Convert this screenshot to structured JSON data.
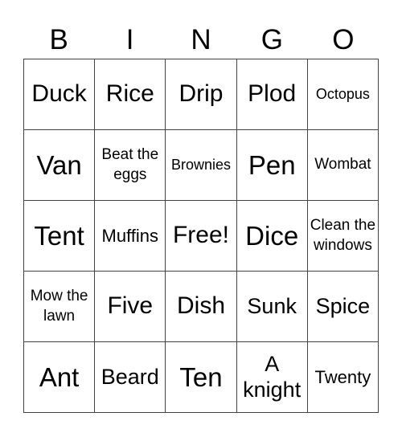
{
  "header": [
    "B",
    "I",
    "N",
    "G",
    "O"
  ],
  "cells": [
    [
      {
        "text": "Duck",
        "size": "l"
      },
      {
        "text": "Rice",
        "size": "l"
      },
      {
        "text": "Drip",
        "size": "l"
      },
      {
        "text": "Plod",
        "size": "l"
      },
      {
        "text": "Octopus",
        "size": "xxs"
      }
    ],
    [
      {
        "text": "Van",
        "size": "xl"
      },
      {
        "text": "Beat the eggs",
        "size": "xs"
      },
      {
        "text": "Brownies",
        "size": "xxs"
      },
      {
        "text": "Pen",
        "size": "xl"
      },
      {
        "text": "Wombat",
        "size": "xs"
      }
    ],
    [
      {
        "text": "Tent",
        "size": "xl"
      },
      {
        "text": "Muffins",
        "size": "s"
      },
      {
        "text": "Free!",
        "size": "l"
      },
      {
        "text": "Dice",
        "size": "xl"
      },
      {
        "text": "Clean the windows",
        "size": "xs"
      }
    ],
    [
      {
        "text": "Mow the lawn",
        "size": "xs"
      },
      {
        "text": "Five",
        "size": "l"
      },
      {
        "text": "Dish",
        "size": "l"
      },
      {
        "text": "Sunk",
        "size": "m"
      },
      {
        "text": "Spice",
        "size": "m"
      }
    ],
    [
      {
        "text": "Ant",
        "size": "xl"
      },
      {
        "text": "Beard",
        "size": "m"
      },
      {
        "text": "Ten",
        "size": "xl"
      },
      {
        "text": "A knight",
        "size": "m"
      },
      {
        "text": "Twenty",
        "size": "s"
      }
    ]
  ]
}
